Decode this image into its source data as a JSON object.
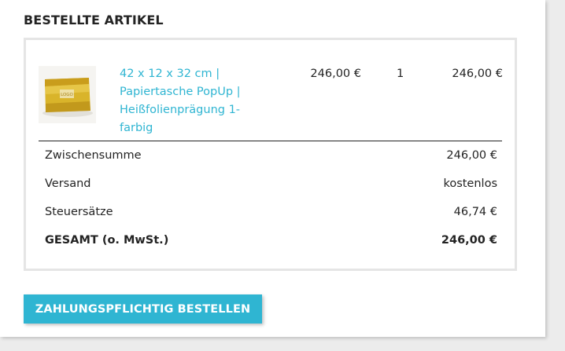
{
  "section": {
    "title": "BESTELLTE ARTIKEL"
  },
  "item": {
    "image_label": "LOGO",
    "name": "42 x 12 x 32 cm | Papiertasche PopUp | Heißfolienprägung 1-farbig",
    "unit_price": "246,00 €",
    "quantity": "1",
    "total_price": "246,00 €"
  },
  "summary": [
    {
      "label": "Zwischensumme",
      "value": "246,00 €"
    },
    {
      "label": "Versand",
      "value": "kostenlos"
    },
    {
      "label": "Steuersätze",
      "value": "46,74 €"
    },
    {
      "label": "GESAMT (o. MwSt.)",
      "value": "246,00 €"
    }
  ],
  "actions": {
    "order_button_label": "ZAHLUNGSPFLICHTIG BESTELLEN"
  },
  "colors": {
    "accent": "#2fb5d2",
    "text": "#232323",
    "border": "#e5e5e5",
    "page_bg": "#ececec",
    "product_gold": "#d9b42a"
  }
}
